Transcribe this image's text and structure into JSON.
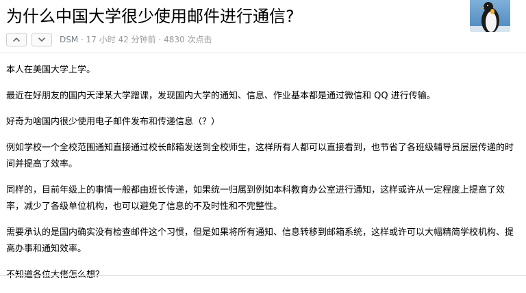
{
  "topic": {
    "title": "为什么中国大学很少使用邮件进行通信?",
    "author": "DSM",
    "meta_rest": " · 17 小时 42 分钟前 · 4830 次点击",
    "upvote_icon": "chevron-up-icon",
    "downvote_icon": "chevron-down-icon",
    "avatar_icon": "penguin-avatar"
  },
  "content": {
    "paragraphs": [
      "本人在美国大学上学。",
      "最近在好朋友的国内天津某大学蹭课，发现国内大学的通知、信息、作业基本都是通过微信和 QQ 进行传输。",
      "好奇为啥国内很少使用电子邮件发布和传递信息（？）",
      "例如学校一个全校范围通知直接通过校长邮箱发送到全校师生，这样所有人都可以直接看到，也节省了各班级辅导员层层传递的时间并提高了效率。",
      "同样的，目前年级上的事情一般都由班长传递，如果统一归属到例如本科教育办公室进行通知，这样或许从一定程度上提高了效率，减少了各级单位机构，也可以避免了信息的不及时性和不完整性。",
      "需要承认的是国内确实没有检查邮件这个习惯，但是如果将所有通知、信息转移到邮箱系统，这样或许可以大幅精简学校机构、提高办事和通知效率。",
      "不知道各位大佬怎么想？"
    ]
  },
  "colors": {
    "meta_text": "#999999",
    "border": "#e2e2e2",
    "button_border": "#cfcfcf"
  }
}
